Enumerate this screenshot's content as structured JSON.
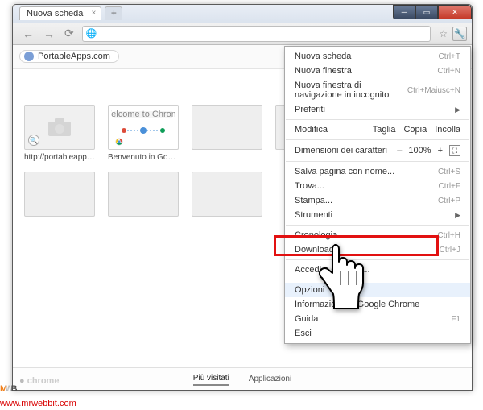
{
  "window": {
    "tab_title": "Nuova scheda"
  },
  "apps_bar": {
    "chip_label": "PortableApps.com"
  },
  "ntp": {
    "tiles": [
      {
        "label": "http://portableapps.c..."
      },
      {
        "label": "Benvenuto in Google..."
      }
    ]
  },
  "footer": {
    "tab_active": "Più visitati",
    "tab_secondary": "Applicazioni",
    "logo_text": "chrome"
  },
  "menu": {
    "new_tab": "Nuova scheda",
    "new_tab_sc": "Ctrl+T",
    "new_window": "Nuova finestra",
    "new_window_sc": "Ctrl+N",
    "incognito": "Nuova finestra di navigazione in incognito",
    "incognito_sc": "Ctrl+Maiusc+N",
    "bookmarks": "Preferiti",
    "edit_label": "Modifica",
    "edit_cut": "Taglia",
    "edit_copy": "Copia",
    "edit_paste": "Incolla",
    "zoom_label": "Dimensioni dei caratteri",
    "zoom_minus": "–",
    "zoom_value": "100%",
    "zoom_plus": "+",
    "save_as": "Salva pagina con nome...",
    "save_as_sc": "Ctrl+S",
    "find": "Trova...",
    "find_sc": "Ctrl+F",
    "print": "Stampa...",
    "print_sc": "Ctrl+P",
    "tools": "Strumenti",
    "history": "Cronologia",
    "history_sc": "Ctrl+H",
    "downloads": "Download",
    "downloads_sc": "Ctrl+J",
    "signin": "Accedi a Chrome...",
    "options": "Opzioni",
    "about": "Informazioni su Google Chrome",
    "help": "Guida",
    "help_sc": "F1",
    "exit": "Esci"
  },
  "watermark": {
    "url": "www.mrwebbit.com"
  }
}
